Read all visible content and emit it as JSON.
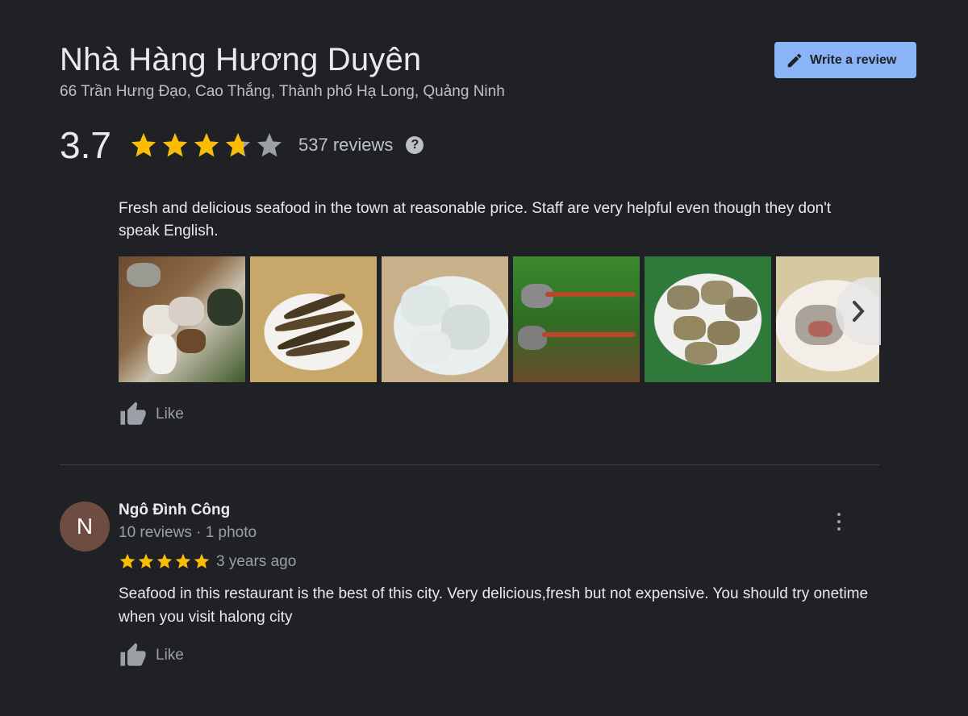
{
  "place": {
    "name": "Nhà Hàng Hương Duyên",
    "address": "66 Trần Hưng Đạo, Cao Thắng, Thành phố Hạ Long, Quảng Ninh"
  },
  "write_review": {
    "label": "Write a review",
    "icon": "pencil-icon"
  },
  "rating": {
    "value": "3.7",
    "stars": 3.7,
    "reviews_label": "537 reviews",
    "help_icon": "?"
  },
  "colors": {
    "accent": "#8ab4f8",
    "star": "#fbbc04",
    "star_empty": "#9aa0a6",
    "background": "#202124",
    "avatar": "#6d4c41"
  },
  "first_review": {
    "text": "Fresh and delicious seafood in the town at reasonable price. Staff are very helpful even though they don't speak English.",
    "photos": [
      "seafood-platter-photo",
      "grilled-razor-clams-photo",
      "squid-photo",
      "vegetables-photo",
      "clams-photo",
      "fish-photo"
    ],
    "like_label": "Like"
  },
  "review": {
    "avatar_letter": "N",
    "author": "Ngô Đình Công",
    "meta": "10 reviews · 1 photo",
    "stars": 5,
    "time": "3 years ago",
    "text": "Seafood in this restaurant is the best of this city. Very delicious,fresh but not expensive. You should try onetime when you visit halong city",
    "like_label": "Like"
  }
}
